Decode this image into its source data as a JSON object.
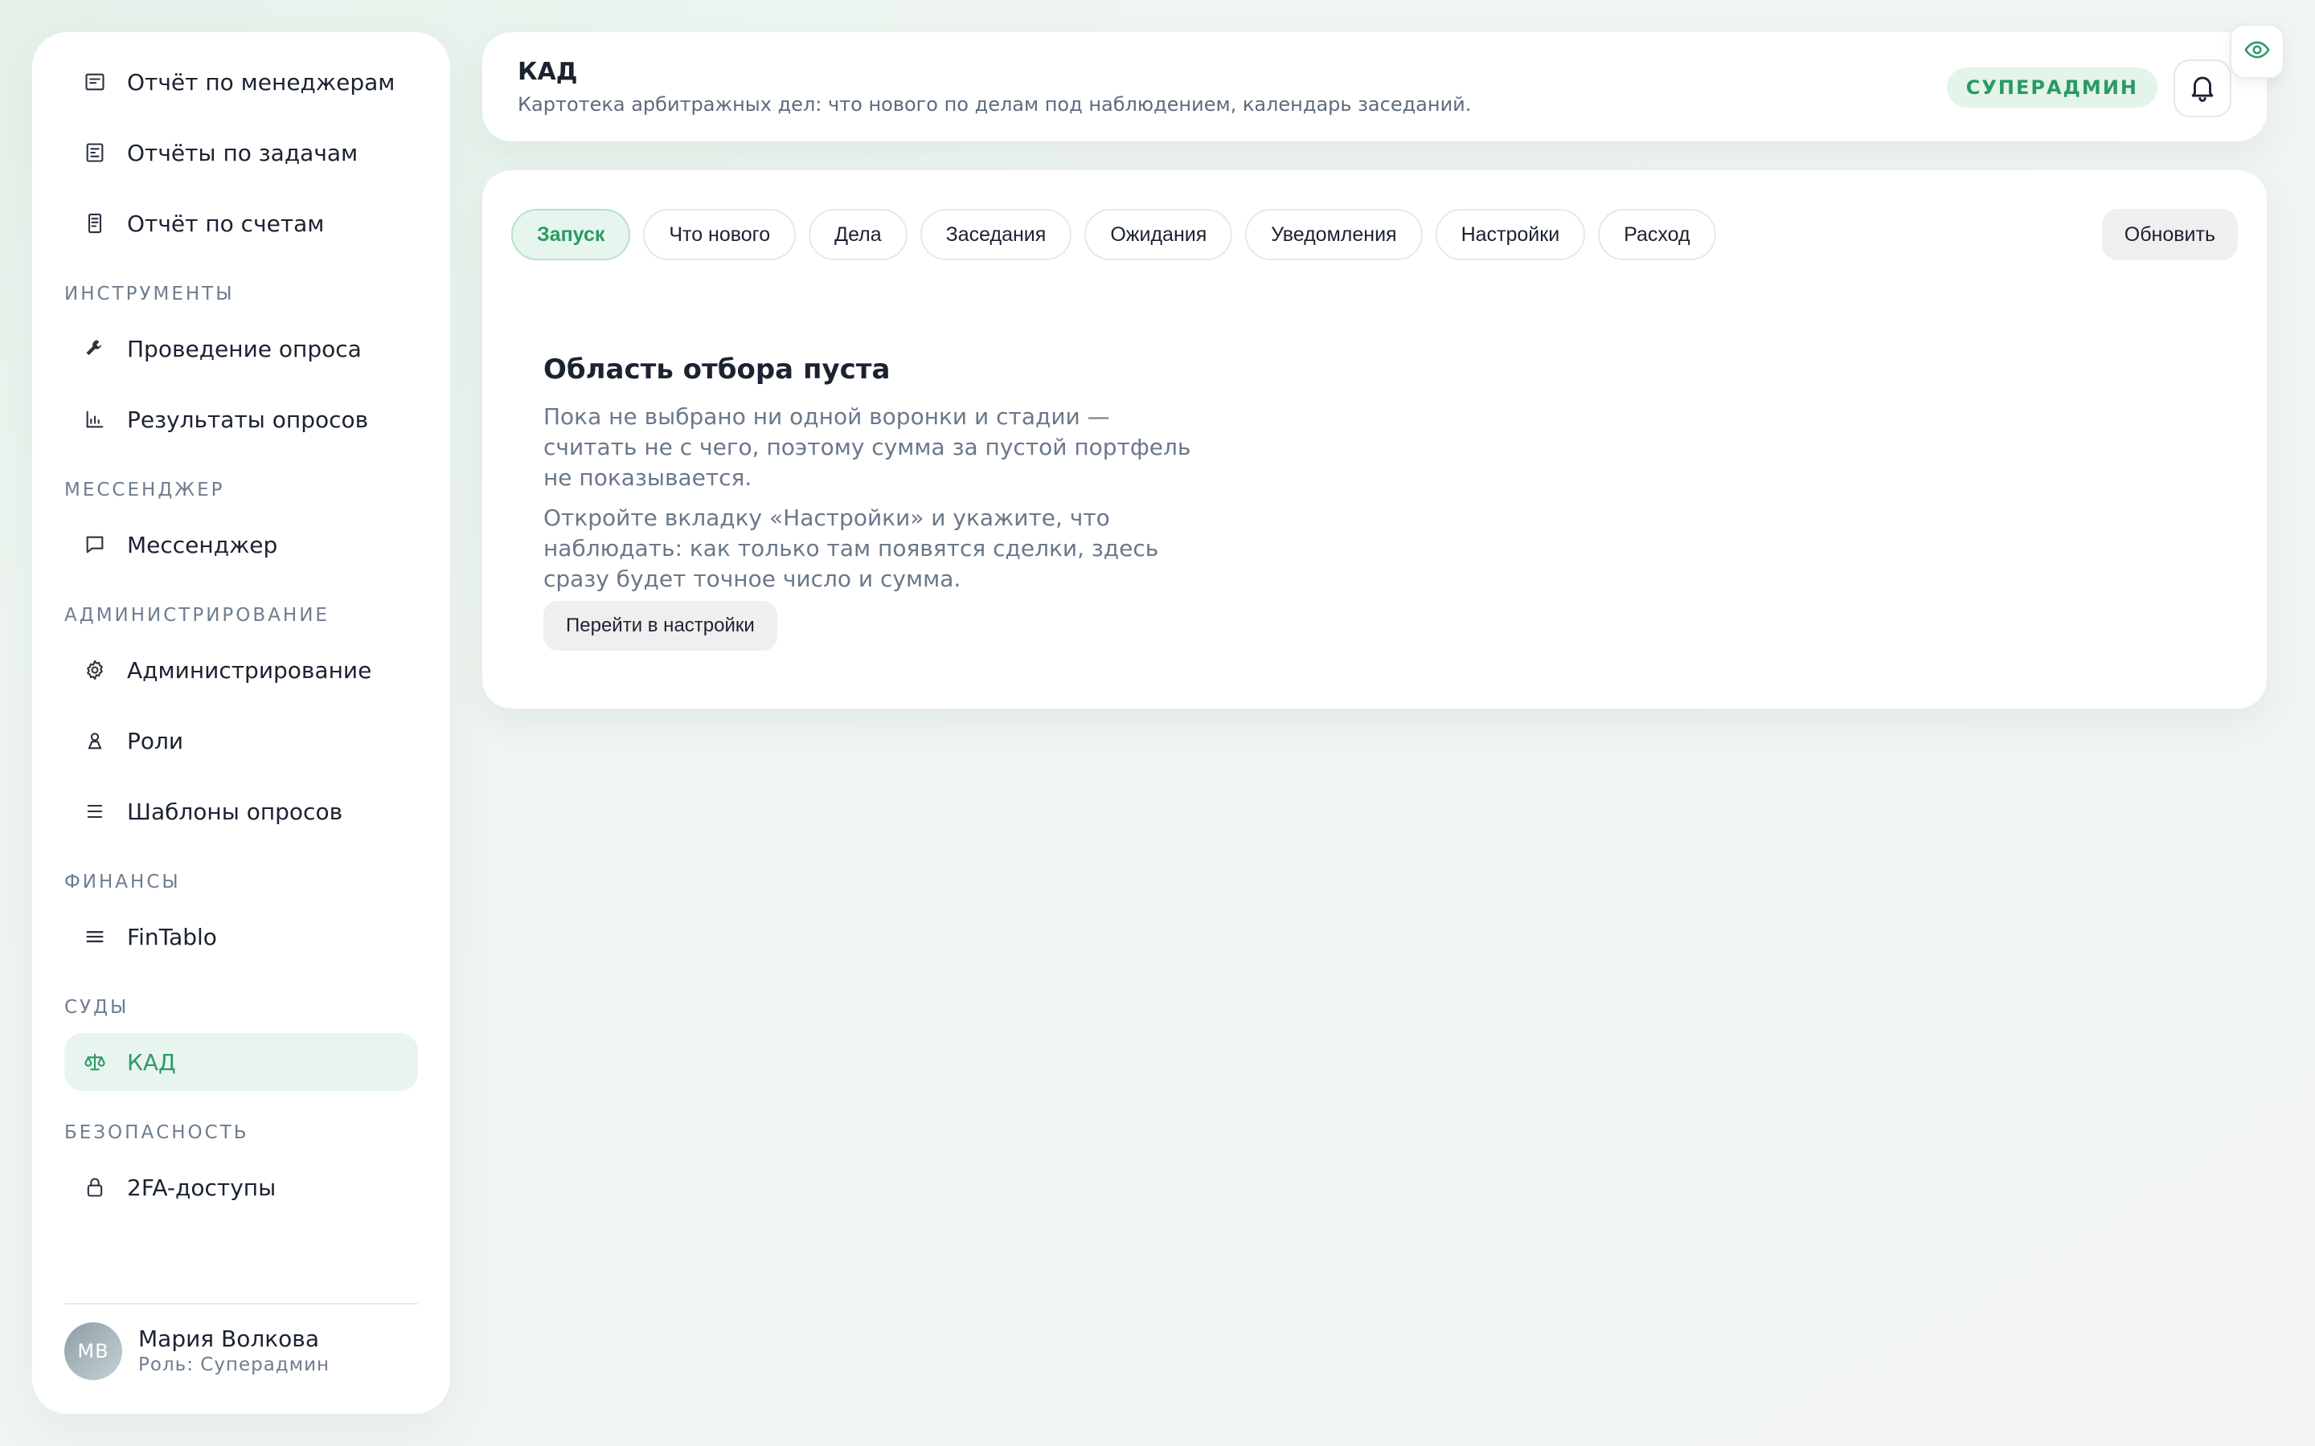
{
  "sidebar": {
    "items_top": [
      {
        "label": "Отчёт по менеджерам",
        "icon": "report-icon"
      },
      {
        "label": "Отчёты по задачам",
        "icon": "tasks-report-icon"
      },
      {
        "label": "Отчёт по счетам",
        "icon": "invoice-icon"
      }
    ],
    "sections": [
      {
        "title": "ИНСТРУМЕНТЫ",
        "items": [
          {
            "label": "Проведение опроса",
            "icon": "wrench-icon"
          },
          {
            "label": "Результаты опросов",
            "icon": "bar-chart-icon"
          }
        ]
      },
      {
        "title": "МЕССЕНДЖЕР",
        "items": [
          {
            "label": "Мессенджер",
            "icon": "chat-icon"
          }
        ]
      },
      {
        "title": "АДМИНИСТРИРОВАНИЕ",
        "items": [
          {
            "label": "Администрирование",
            "icon": "gear-icon"
          },
          {
            "label": "Роли",
            "icon": "user-icon"
          },
          {
            "label": "Шаблоны опросов",
            "icon": "list-icon"
          }
        ]
      },
      {
        "title": "ФИНАНСЫ",
        "items": [
          {
            "label": "FinTablo",
            "icon": "menu-lines-icon"
          }
        ]
      },
      {
        "title": "СУДЫ",
        "items": [
          {
            "label": "КАД",
            "icon": "scales-icon",
            "active": true
          }
        ]
      },
      {
        "title": "БЕЗОПАСНОСТЬ",
        "items": [
          {
            "label": "2FA-доступы",
            "icon": "lock-icon"
          }
        ]
      }
    ],
    "user": {
      "initials": "МВ",
      "name": "Мария Волкова",
      "role": "Роль: Суперадмин"
    }
  },
  "header": {
    "title": "КАД",
    "subtitle": "Картотека арбитражных дел: что нового по делам под наблюдением, календарь заседаний.",
    "role_badge": "СУПЕРАДМИН"
  },
  "main": {
    "tabs": [
      {
        "label": "Запуск",
        "active": true
      },
      {
        "label": "Что нового"
      },
      {
        "label": "Дела"
      },
      {
        "label": "Заседания"
      },
      {
        "label": "Ожидания"
      },
      {
        "label": "Уведомления"
      },
      {
        "label": "Настройки"
      },
      {
        "label": "Расход"
      }
    ],
    "refresh_label": "Обновить",
    "empty": {
      "title": "Область отбора пуста",
      "text1": "Пока не выбрано ни одной воронки и стадии — считать не с чего, поэтому сумма за пустой портфель не показывается.",
      "text2": "Откройте вкладку «Настройки» и укажите, что наблюдать: как только там появятся сделки, здесь сразу будет точное число и сумма.",
      "button": "Перейти в настройки"
    }
  },
  "colors": {
    "accent": "#2e9a68",
    "accent_bg": "#e8f5ee",
    "text": "#1b2230",
    "muted": "#6e7d8f"
  }
}
